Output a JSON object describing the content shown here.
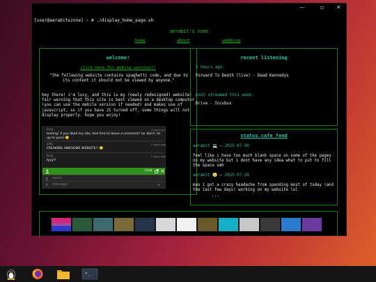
{
  "window": {
    "min_glyph": "—",
    "max_glyph": "▫",
    "close_glyph": "✕"
  },
  "terminal": {
    "prompt": "[user@aerabitszone] ~ # ./display_home_page.sh"
  },
  "site": {
    "title": "aerabit's zone",
    "nav": [
      "home",
      "about",
      "webbing"
    ]
  },
  "welcome": {
    "heading": "welcome!",
    "mobile_link": "click here for mobile version!!",
    "quote": "\"the following website contains spaghetti code, and due to its content it should not be viewed by anyone.\"",
    "body": "hey there! i'm lucy, and this is my (newly redesigned) website! fair warning that this site is best viewed on a desktop computer (you can use the mobile version if needed) and makes use of javascript, so if you have JS turned off, some things will not display properly. hope you enjoy!"
  },
  "chat": {
    "messages": [
      {
        "name": "lucy",
        "date": "2 days ago",
        "text": "testing! if you liked my site, feel free to leave a comment! (or don't, its up to you!) 🙂"
      },
      {
        "name": "silly",
        "date": "2 days ago",
        "text": "FREAKING AWESOME WEBSITE!! 🙂"
      },
      {
        "name": "lucy",
        "date": "2 days ago",
        "text": "tyyy!!"
      }
    ],
    "bar_label": "Chat",
    "name_placeholder": "name",
    "message_placeholder": "message"
  },
  "recent": {
    "heading": "recent listening",
    "time_label": "5 hours ago:",
    "track": "Forward To Death (live) - Dead Kennedys",
    "most_label": "most streamed this week:",
    "most_track": "Drive - Incubus"
  },
  "status": {
    "heading": "status.cafe feed",
    "entries": [
      {
        "user": "aerabit",
        "emoji": "💻",
        "date": "2025-07-30",
        "text": "feel like i have too much blank space on some of the pages on my website but i dont have any idea what to put to fill the space smh"
      },
      {
        "user": "aerabit",
        "emoji": "🤕",
        "date": "2025-07-29",
        "text": "man i got a crazy headache from spending most of today (and the last few days) working on my website lol"
      }
    ],
    "more": "..."
  },
  "badges": [
    {
      "name": "bisexual-flag-badge",
      "color": "#d8247a"
    },
    {
      "name": "album-art-badge-1",
      "color": "#2a5a3a"
    },
    {
      "name": "album-art-badge-2",
      "color": "#3d6a6e"
    },
    {
      "name": "album-art-badge-3",
      "color": "#7a6a3a"
    },
    {
      "name": "album-art-badge-4",
      "color": "#27354a"
    },
    {
      "name": "album-art-badge-5",
      "color": "#d8d8d8"
    },
    {
      "name": "blink182-smiley-badge",
      "color": "#f2f2f2"
    },
    {
      "name": "album-art-badge-7",
      "color": "#6a5a2a"
    },
    {
      "name": "album-art-badge-8",
      "color": "#15b0c8"
    },
    {
      "name": "album-art-badge-9",
      "color": "#c8c8c8"
    },
    {
      "name": "album-art-badge-10",
      "color": "#3a3a3a"
    },
    {
      "name": "album-art-badge-11",
      "color": "#2a7ad0"
    },
    {
      "name": "album-art-badge-12",
      "color": "#6a3aa0"
    }
  ],
  "taskbar": {
    "items": [
      "linux-penguin-icon",
      "firefox-icon",
      "files-folder-icon",
      "terminal-icon"
    ],
    "terminal_glyph": ">_"
  },
  "colors": {
    "accent_green": "#1ec31e",
    "heading_teal": "#27c4a8",
    "box_border": "#1d7a1d"
  }
}
